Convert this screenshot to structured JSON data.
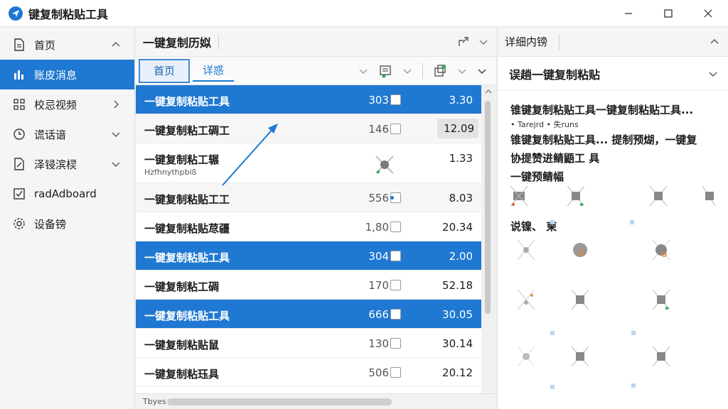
{
  "app": {
    "title": "键复制粘贴工具"
  },
  "sidebar": {
    "items": [
      {
        "label": "首页",
        "icon": "document-icon"
      },
      {
        "label": "账皮消息",
        "icon": "bar-chart-icon"
      },
      {
        "label": "校忌视频",
        "icon": "grid-icon"
      },
      {
        "label": "谎话谙",
        "icon": "clock-icon"
      },
      {
        "label": "泽锓滨棂",
        "icon": "doc-edit-icon"
      },
      {
        "label": "radAdboard",
        "icon": "checkbox-icon"
      },
      {
        "label": "设备镑",
        "icon": "gear-icon"
      }
    ]
  },
  "middle": {
    "header_title": "一键复制历姒",
    "tabs": [
      {
        "label": "首页"
      },
      {
        "label": "详惑"
      }
    ],
    "rows": [
      {
        "name": "一键复制粘贴工具",
        "count": "303",
        "value": "3.30"
      },
      {
        "name": "一键复制粘工碉工",
        "count": "146",
        "value": "12.09"
      },
      {
        "name": "一键复制粘工辗",
        "sub": "Hzfhnythpbiß",
        "count": "",
        "value": "1.33"
      },
      {
        "name": "一键复制粘贴工工",
        "count": "556",
        "value": "8.03"
      },
      {
        "name": "一键复制粘贴荩疆",
        "count": "1,80",
        "value": "20.34"
      },
      {
        "name": "一键复制粘贴工具",
        "count": "304",
        "value": "2.00"
      },
      {
        "name": "一键复制粘工碉",
        "count": "170",
        "value": "52.18"
      },
      {
        "name": "一键复制粘贴工具",
        "count": "666",
        "value": "30.05"
      },
      {
        "name": "一键复制粘贴鼠",
        "count": "130",
        "value": "30.14"
      },
      {
        "name": "一键复制粘珏具",
        "count": "506",
        "value": "20.12"
      }
    ],
    "status_label": "Tbyes"
  },
  "right_panel": {
    "header_title": "详细内镑",
    "section_title": "误趟一键复制粘贴",
    "line1": "锥键复制粘贴工具一键复制粘贴工具...",
    "line1_meta": "• Tarejrd • 失runs",
    "line2": "锥键复制粘贴工具...  提制预煳，一键复",
    "line3": "协提赞进鲭鼯工 具",
    "line4": "一键预鲭幅",
    "line5": "说镍、 柬"
  },
  "colors": {
    "accent": "#1f78d1",
    "selected_row": "#1f78d1"
  }
}
